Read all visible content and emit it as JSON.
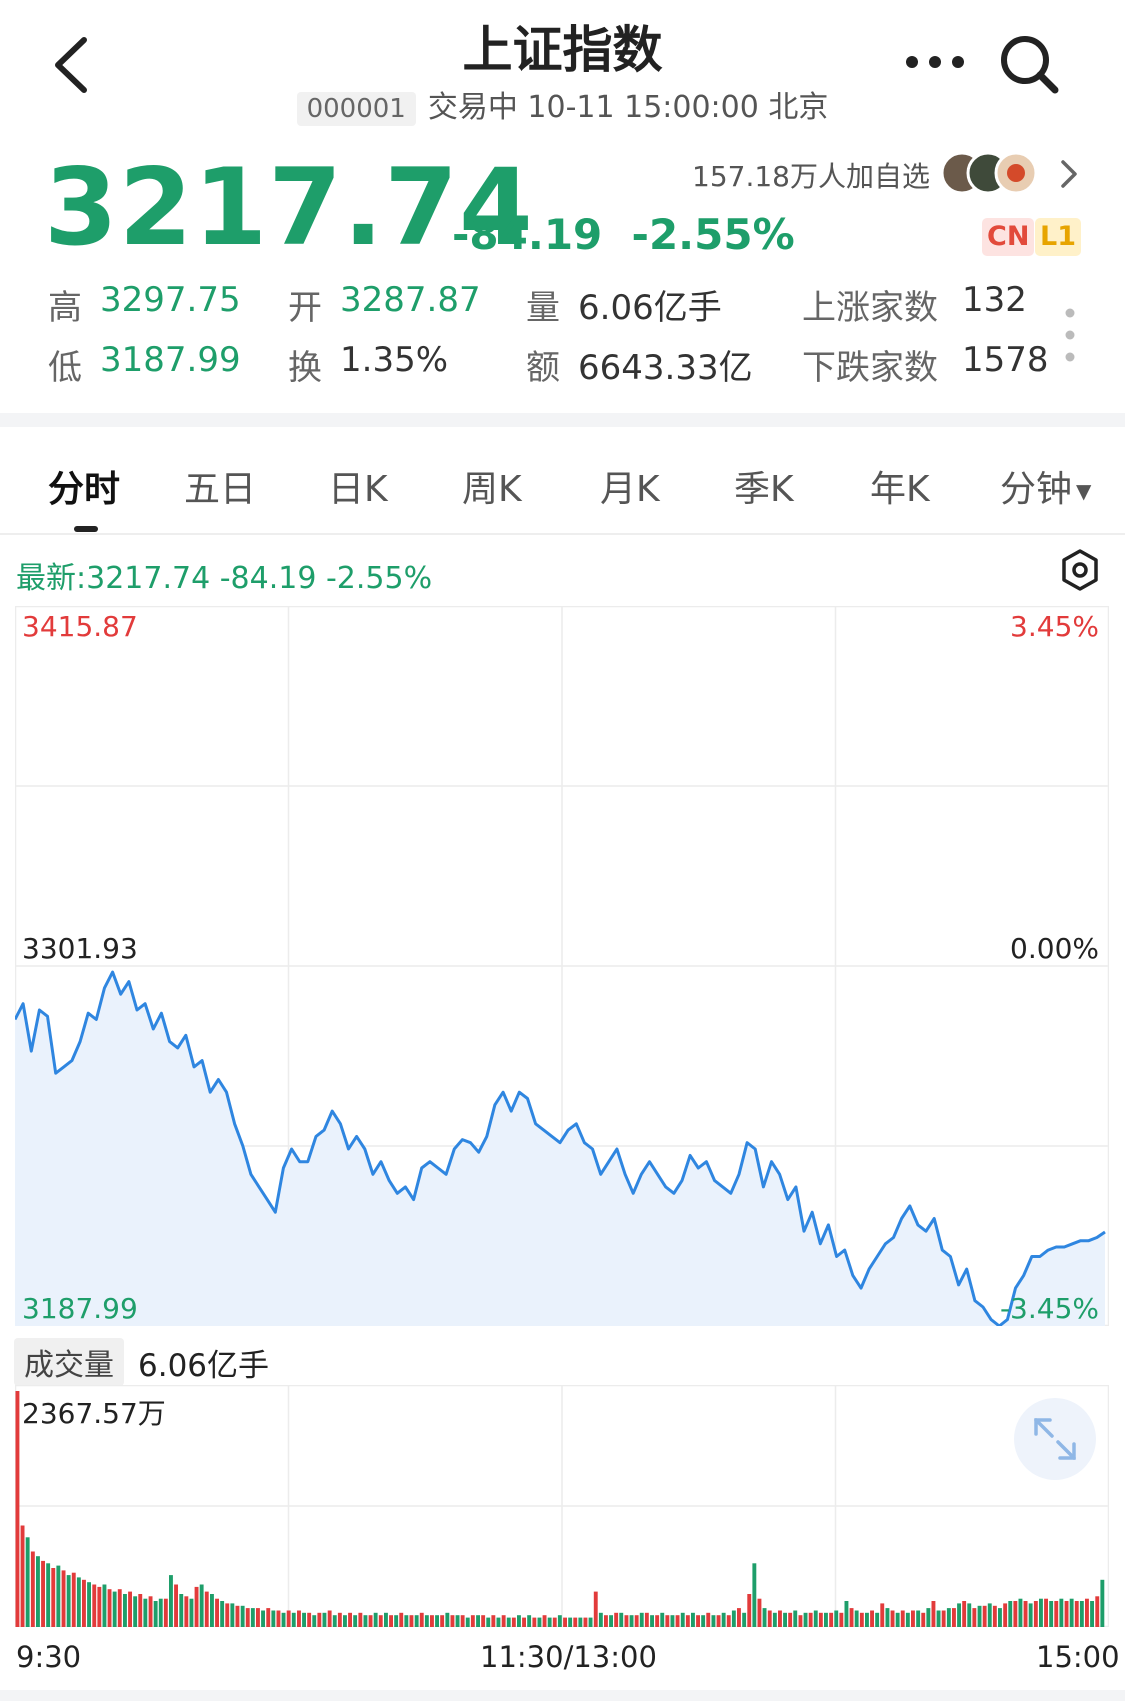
{
  "header": {
    "title": "上证指数",
    "code": "000001",
    "status_line": "交易中 10-11 15:00:00 北京"
  },
  "quote": {
    "price": "3217.74",
    "change": "-84.19",
    "change_pct": "-2.55%",
    "watchers": "157.18万人加自选",
    "tag_cn": "CN",
    "tag_l1": "L1"
  },
  "stats": {
    "high_label": "高",
    "high": "3297.75",
    "low_label": "低",
    "low": "3187.99",
    "open_label": "开",
    "open": "3287.87",
    "turnover_label": "换",
    "turnover": "1.35%",
    "volume_label": "量",
    "volume": "6.06亿手",
    "amount_label": "额",
    "amount": "6643.33亿",
    "up_label": "上涨家数",
    "up_count": "132",
    "down_label": "下跌家数",
    "down_count": "1578"
  },
  "tabs": [
    "分时",
    "五日",
    "日K",
    "周K",
    "月K",
    "季K",
    "年K",
    "分钟"
  ],
  "active_tab": "分时",
  "latest_line": "最新:3217.74  -84.19  -2.55%",
  "colors": {
    "up": "#e23b3b",
    "down": "#1e9e6a",
    "line": "#2f86e0",
    "fill": "#eaf2fc"
  },
  "chart_data": [
    {
      "type": "line",
      "y_left_ticks": [
        "3415.87",
        "3301.93",
        "3187.99"
      ],
      "y_right_ticks": [
        "3.45%",
        "0.00%",
        "-3.45%"
      ],
      "ylim": [
        3187.99,
        3415.87
      ],
      "x_ticks": [
        "9:30",
        "11:30/13:00",
        "15:00"
      ],
      "grid": true,
      "series": [
        {
          "values": [
            3285,
            3290,
            3275,
            3288,
            3286,
            3268,
            3270,
            3272,
            3278,
            3287,
            3285,
            3295,
            3300,
            3293,
            3297,
            3288,
            3290,
            3282,
            3287,
            3278,
            3276,
            3280,
            3270,
            3272,
            3262,
            3266,
            3262,
            3252,
            3245,
            3236,
            3232,
            3228,
            3224,
            3238,
            3244,
            3240,
            3240,
            3248,
            3250,
            3256,
            3252,
            3244,
            3248,
            3244,
            3236,
            3240,
            3234,
            3230,
            3232,
            3228,
            3238,
            3240,
            3238,
            3236,
            3244,
            3247,
            3246,
            3243,
            3248,
            3258,
            3262,
            3256,
            3262,
            3260,
            3252,
            3250,
            3248,
            3246,
            3250,
            3252,
            3246,
            3244,
            3236,
            3240,
            3244,
            3236,
            3230,
            3236,
            3240,
            3236,
            3232,
            3230,
            3234,
            3242,
            3238,
            3240,
            3234,
            3232,
            3230,
            3236,
            3246,
            3244,
            3232,
            3240,
            3236,
            3228,
            3232,
            3218,
            3224,
            3214,
            3220,
            3210,
            3212,
            3204,
            3200,
            3206,
            3210,
            3214,
            3216,
            3222,
            3226,
            3220,
            3218,
            3222,
            3212,
            3210,
            3201,
            3206,
            3196,
            3194,
            3190,
            3188,
            3190,
            3200,
            3204,
            3210,
            3210,
            3212,
            3213,
            3213,
            3214,
            3215,
            3215,
            3216,
            3217.74
          ]
        }
      ]
    },
    {
      "type": "bar",
      "x_ticks": [
        "9:30",
        "11:30/13:00",
        "15:00"
      ],
      "max_label": "2367.57万",
      "total_label": "6.06亿手",
      "legend_tag": "成交量",
      "values": [
        100,
        43,
        38,
        32,
        30,
        28,
        27,
        25,
        26,
        24,
        22,
        23,
        21,
        20,
        19,
        18,
        17,
        18,
        16,
        15,
        16,
        14,
        15,
        13,
        14,
        12,
        13,
        11,
        12,
        12,
        22,
        18,
        14,
        13,
        12,
        17,
        18,
        15,
        14,
        12,
        11,
        10,
        10,
        9,
        9,
        8,
        8,
        8,
        7,
        8,
        7,
        7,
        6,
        7,
        6,
        7,
        6,
        6,
        5,
        6,
        6,
        7,
        5,
        6,
        5,
        6,
        5,
        6,
        5,
        5,
        6,
        5,
        6,
        5,
        5,
        6,
        5,
        5,
        5,
        6,
        5,
        5,
        5,
        5,
        6,
        5,
        5,
        5,
        4,
        5,
        5,
        5,
        4,
        5,
        4,
        5,
        4,
        4,
        5,
        4,
        5,
        4,
        4,
        5,
        4,
        4,
        5,
        4,
        4,
        4,
        4,
        4,
        4,
        15,
        6,
        5,
        5,
        6,
        6,
        5,
        5,
        5,
        6,
        6,
        5,
        5,
        6,
        5,
        5,
        5,
        6,
        5,
        6,
        5,
        5,
        6,
        5,
        5,
        6,
        5,
        7,
        8,
        6,
        14,
        27,
        12,
        8,
        7,
        6,
        7,
        6,
        6,
        7,
        5,
        6,
        6,
        7,
        6,
        6,
        6,
        7,
        6,
        11,
        8,
        7,
        6,
        6,
        7,
        6,
        10,
        8,
        7,
        6,
        7,
        6,
        7,
        7,
        6,
        8,
        11,
        7,
        7,
        8,
        8,
        10,
        11,
        10,
        8,
        9,
        9,
        10,
        9,
        8,
        10,
        11,
        11,
        12,
        11,
        10,
        11,
        12,
        12,
        11,
        11,
        12,
        11,
        12,
        11,
        11,
        12,
        11,
        13,
        20
      ],
      "colors": [
        "up",
        "up",
        "down",
        "up",
        "down",
        "up",
        "down",
        "up",
        "down",
        "up",
        "down",
        "up",
        "down",
        "up",
        "down",
        "up",
        "up",
        "down",
        "up",
        "down",
        "up",
        "down",
        "up",
        "down",
        "up",
        "down",
        "up",
        "down",
        "down",
        "up",
        "down",
        "up",
        "down",
        "up",
        "down",
        "up",
        "down",
        "up",
        "down",
        "up",
        "down",
        "up",
        "down",
        "up",
        "down",
        "up",
        "down",
        "up",
        "down",
        "up",
        "down",
        "up",
        "down",
        "up",
        "down",
        "up",
        "down",
        "up",
        "down",
        "up",
        "down",
        "up",
        "down",
        "up",
        "down",
        "up",
        "down",
        "up",
        "down",
        "up",
        "down",
        "up",
        "down",
        "up",
        "down",
        "up",
        "down",
        "up",
        "down",
        "up",
        "down",
        "up",
        "down",
        "up",
        "down",
        "up",
        "down",
        "up",
        "down",
        "up",
        "down",
        "up",
        "down",
        "up",
        "down",
        "up",
        "down",
        "up",
        "down",
        "up",
        "down",
        "up",
        "down",
        "up",
        "down",
        "up",
        "down",
        "up",
        "down",
        "up",
        "down",
        "up",
        "down",
        "up",
        "down",
        "up",
        "down",
        "up",
        "down",
        "up",
        "down",
        "up",
        "down",
        "up",
        "down",
        "up",
        "down",
        "up",
        "down",
        "up",
        "down",
        "up",
        "down",
        "up",
        "down",
        "up",
        "down",
        "up",
        "down",
        "up",
        "down",
        "up",
        "down",
        "up",
        "down",
        "up",
        "down",
        "up",
        "down",
        "up",
        "down",
        "up",
        "down",
        "up",
        "down",
        "up",
        "down",
        "up",
        "down",
        "up",
        "down",
        "up",
        "down",
        "up",
        "down",
        "up",
        "down",
        "up",
        "down",
        "up",
        "down",
        "up",
        "down",
        "up",
        "down",
        "up",
        "down",
        "up",
        "down",
        "up",
        "down",
        "up",
        "down",
        "up",
        "down",
        "up",
        "down",
        "up",
        "down",
        "up",
        "down",
        "up",
        "down",
        "up",
        "down",
        "up",
        "down",
        "up",
        "down",
        "up",
        "down",
        "up",
        "down",
        "up",
        "down",
        "up",
        "down",
        "up",
        "down",
        "up",
        "down",
        "up"
      ]
    }
  ]
}
